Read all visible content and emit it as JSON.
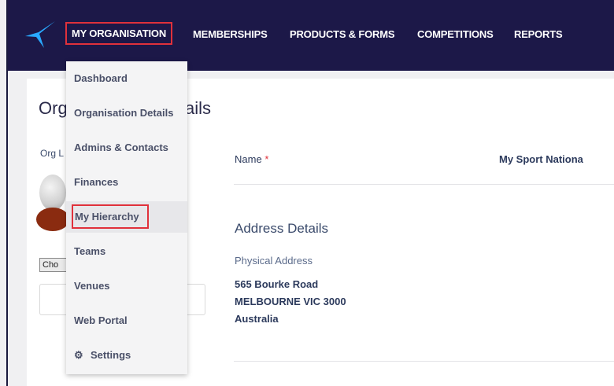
{
  "nav": {
    "items": [
      "MY ORGANISATION",
      "MEMBERSHIPS",
      "PRODUCTS & FORMS",
      "COMPETITIONS",
      "REPORTS"
    ],
    "brand_color": "#1c1848",
    "highlight_color": "#e0313b"
  },
  "dropdown": {
    "items": [
      "Dashboard",
      "Organisation Details",
      "Admins & Contacts",
      "Finances",
      "My Hierarchy",
      "Teams",
      "Venues",
      "Web Portal",
      "Settings"
    ],
    "settings_icon": "gear-icon"
  },
  "page": {
    "title_start": "Org",
    "title_end": "ails",
    "org_label": "Org L",
    "choose_label": "Cho"
  },
  "details": {
    "name_label": "Name",
    "required_mark": "*",
    "name_value": "My Sport Nationa",
    "address_title": "Address Details",
    "physical_label": "Physical Address",
    "address_lines": [
      "565 Bourke Road",
      "MELBOURNE VIC 3000",
      "Australia"
    ]
  }
}
